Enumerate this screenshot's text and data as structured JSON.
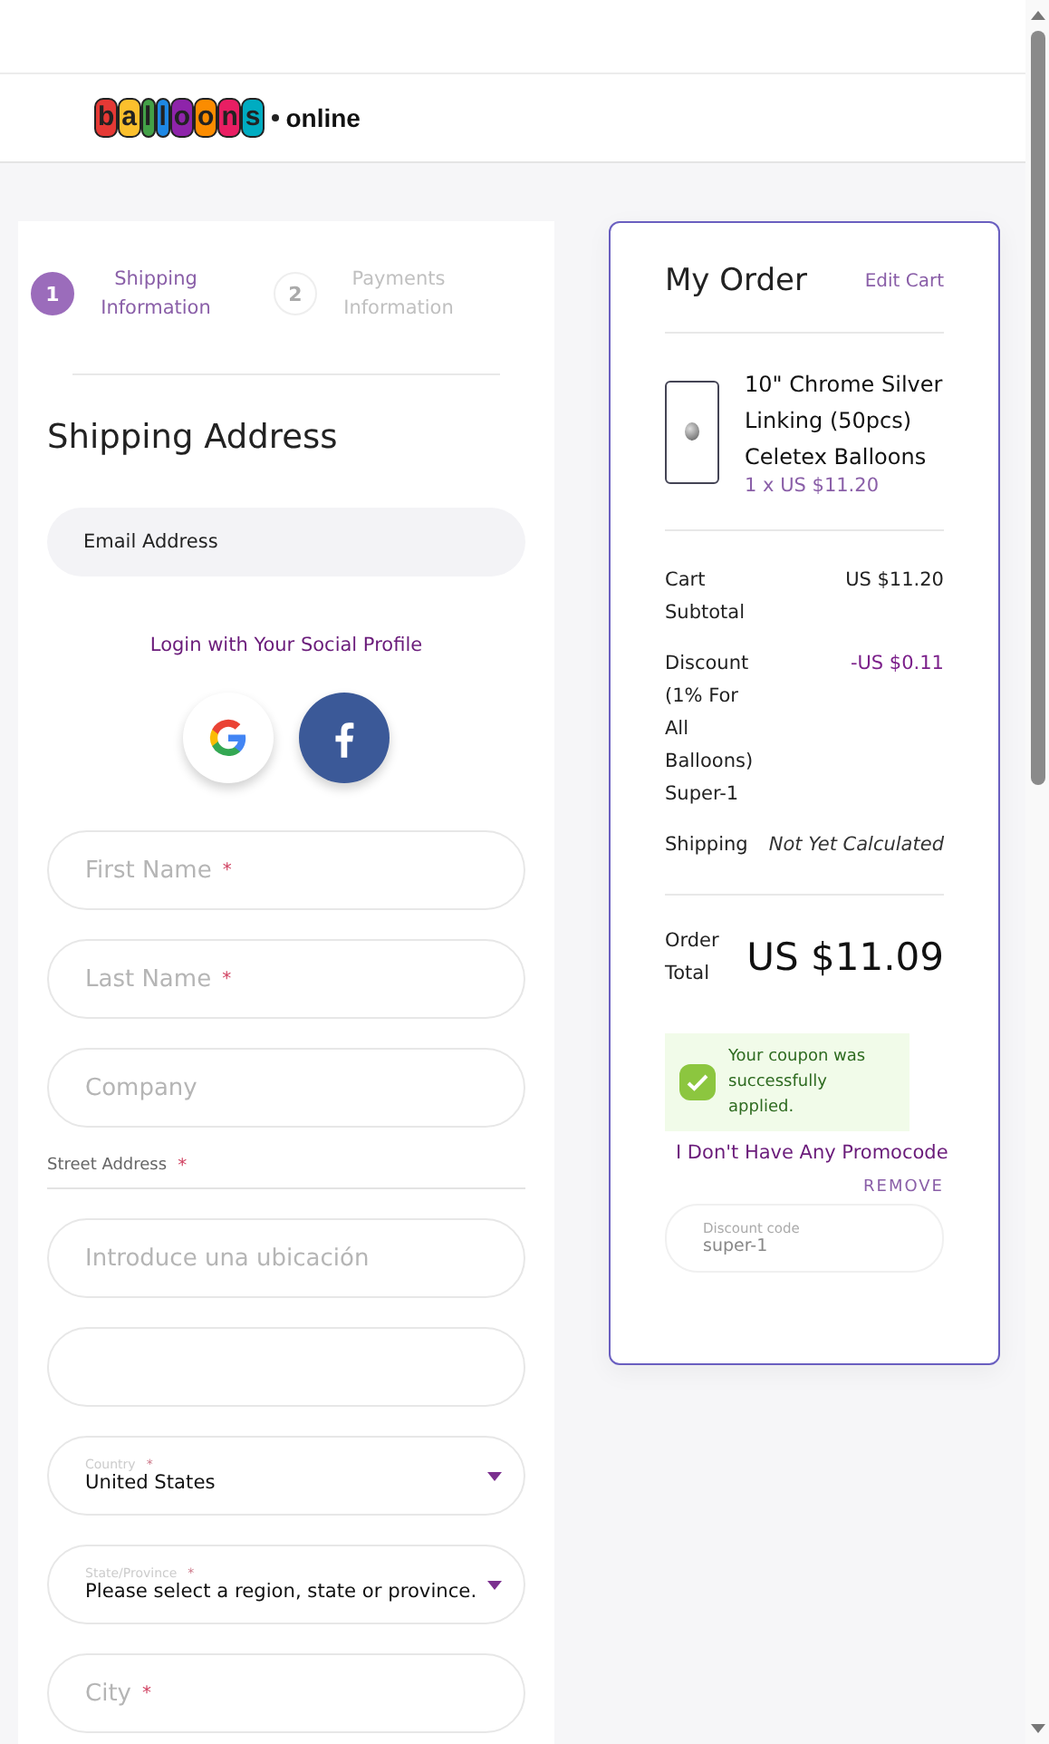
{
  "header": {
    "logo": {
      "brand": "balloons",
      "suffix": "online"
    }
  },
  "steps": [
    {
      "number": "1",
      "label": "Shipping Information",
      "selected": true
    },
    {
      "number": "2",
      "label": "Payments Information",
      "selected": false
    }
  ],
  "shipping": {
    "title": "Shipping Address",
    "email": {
      "placeholder": "Email Address"
    },
    "social": {
      "label": "Login with Your Social Profile"
    },
    "fields": [
      {
        "kind": "text",
        "placeholder": "First Name",
        "required_mark": "*"
      },
      {
        "kind": "text",
        "placeholder": "Last Name",
        "required_mark": "*"
      },
      {
        "kind": "text",
        "placeholder": "Company"
      },
      {
        "kind": "section",
        "label": "Street Address",
        "required_mark": "*"
      },
      {
        "kind": "text",
        "placeholder": "Introduce una ubicación"
      },
      {
        "kind": "text"
      },
      {
        "kind": "select",
        "label": "Country",
        "value": "United States",
        "required_mark": "*"
      },
      {
        "kind": "select",
        "label": "State/Province",
        "value": "Please select a region, state or province.",
        "required_mark": "*"
      },
      {
        "kind": "text",
        "placeholder": "City",
        "required_mark": "*"
      }
    ]
  },
  "order": {
    "title": "My Order",
    "edit_link": "Edit Cart",
    "items": [
      {
        "name": "10\" Chrome Silver Linking (50pcs) Celetex Balloons",
        "price": "1 x US $11.20"
      }
    ],
    "summary": [
      {
        "kind": "plain",
        "label": "Cart Subtotal",
        "value": "US $11.20"
      },
      {
        "kind": "discount",
        "label": "Discount (1% For All Balloons) Super-1",
        "value": "-US $0.11"
      },
      {
        "kind": "note",
        "label": "Shipping",
        "value": "Not Yet Calculated"
      }
    ],
    "total": {
      "label": "Order Total",
      "value": "US $11.09"
    },
    "coupon_message": "Your coupon was successfully applied.",
    "promo_link": "I Don't Have Any Promocode",
    "remove_button": "REMOVE",
    "discount_field": {
      "label": "Discount code",
      "value": "super-1"
    }
  }
}
